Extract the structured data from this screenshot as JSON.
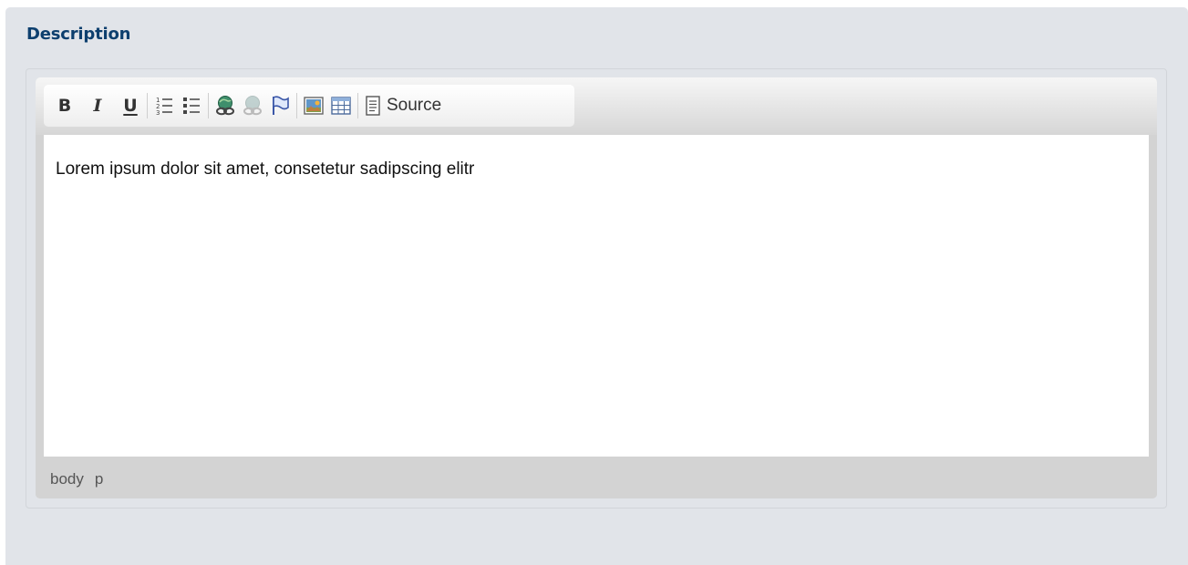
{
  "section": {
    "title": "Description"
  },
  "toolbar": {
    "buttons": [
      {
        "label": "B",
        "icon": "bold-icon"
      },
      {
        "label": "I",
        "icon": "italic-icon"
      },
      {
        "label": "U",
        "icon": "underline-icon"
      },
      {
        "icon": "numbered-list-icon"
      },
      {
        "icon": "bulleted-list-icon"
      },
      {
        "icon": "link-icon"
      },
      {
        "icon": "unlink-icon"
      },
      {
        "icon": "anchor-flag-icon"
      },
      {
        "icon": "image-icon"
      },
      {
        "icon": "table-icon"
      },
      {
        "icon": "source-icon",
        "label": "Source"
      }
    ],
    "source_label": "Source"
  },
  "editor": {
    "content": "Lorem ipsum dolor sit amet, consetetur sadipscing elitr"
  },
  "statusbar": {
    "path": [
      "body",
      "p"
    ]
  },
  "colors": {
    "panel_bg": "#e1e4e9",
    "title": "#0d3f6e",
    "editor_chrome": "#d3d3d3"
  }
}
